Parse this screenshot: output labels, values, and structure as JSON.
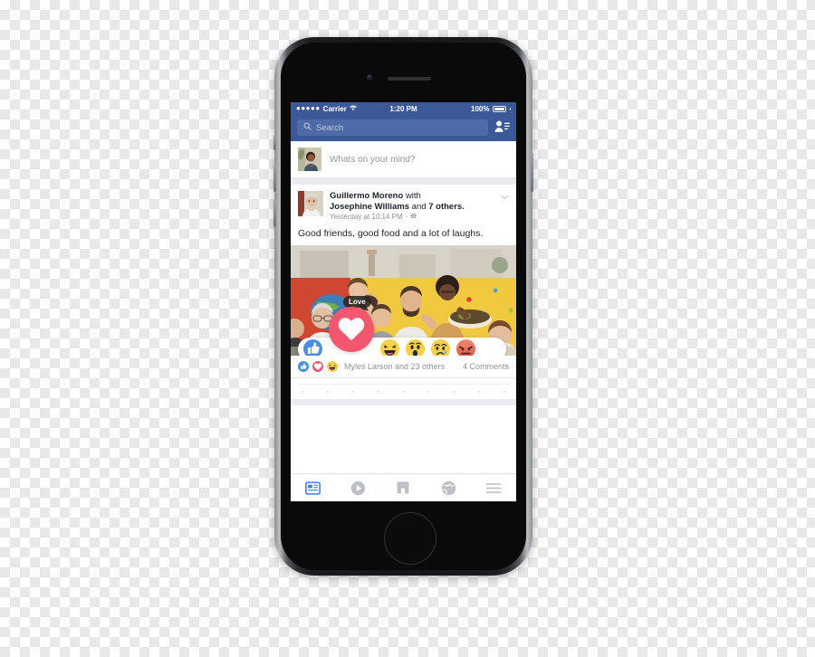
{
  "device": {
    "name": "iphone-mockup",
    "camera": "front-camera",
    "speaker": "earpiece-speaker",
    "home_button": "home-button",
    "buttons": [
      "silent-switch",
      "volume-up",
      "volume-down",
      "power-button"
    ]
  },
  "status_bar": {
    "signal_dots": "●●●●●",
    "carrier": "Carrier",
    "wifi_icon": "wifi-icon",
    "time": "1:20 PM",
    "battery_percent": "100%"
  },
  "navbar": {
    "search_icon": "search-icon",
    "search_placeholder": "Search",
    "search_value": "",
    "friend_requests_icon": "friend-requests-icon"
  },
  "composer": {
    "avatar": "user-avatar",
    "placeholder": "Whats on your mind?"
  },
  "post": {
    "author": "Guillermo Moreno",
    "with_word": "with",
    "tagged": "Josephine Williams",
    "and_word": "and",
    "others": "7 others.",
    "timestamp": "Yesterday at 10:14 PM",
    "separator": "·",
    "privacy_icon": "globe-icon",
    "chevron_icon": "chevron-down-icon",
    "text": "Good friends, good food and a lot of laughs.",
    "photo_alt": "friends-sharing-meal-photo"
  },
  "reactions": {
    "tooltip_label": "Love",
    "selected": "love",
    "items": [
      {
        "name": "like",
        "icon": "thumbs-up-icon",
        "color": "#4a90e2"
      },
      {
        "name": "love",
        "icon": "heart-icon",
        "color": "#f2576e"
      },
      {
        "name": "haha",
        "icon": "haha-face-icon",
        "color": "#f7d04a"
      },
      {
        "name": "wow",
        "icon": "wow-face-icon",
        "color": "#f7d04a"
      },
      {
        "name": "sad",
        "icon": "sad-face-icon",
        "color": "#f7d04a"
      },
      {
        "name": "angry",
        "icon": "angry-face-icon",
        "color": "#ec7263"
      }
    ]
  },
  "counts": {
    "badges": [
      "like-badge",
      "love-badge",
      "haha-badge"
    ],
    "names": "Myles Larson and 23 others",
    "comments": "4 Comments"
  },
  "tabbar": {
    "items": [
      {
        "name": "news-feed-tab",
        "icon": "news-feed-icon",
        "active": true
      },
      {
        "name": "video-tab",
        "icon": "play-circle-icon",
        "active": false
      },
      {
        "name": "marketplace-tab",
        "icon": "marketplace-icon",
        "active": false
      },
      {
        "name": "notifications-tab",
        "icon": "globe-icon",
        "active": false
      },
      {
        "name": "menu-tab",
        "icon": "hamburger-menu-icon",
        "active": false
      }
    ]
  },
  "colors": {
    "facebook_blue": "#3b5998",
    "search_field": "#4f6aa8",
    "love_pink": "#f2576e",
    "like_blue": "#4a90e2",
    "emoji_yellow": "#f7d04a",
    "angry_red": "#ec7263",
    "feed_gray": "#e9ebee",
    "muted_text": "#90949c"
  }
}
